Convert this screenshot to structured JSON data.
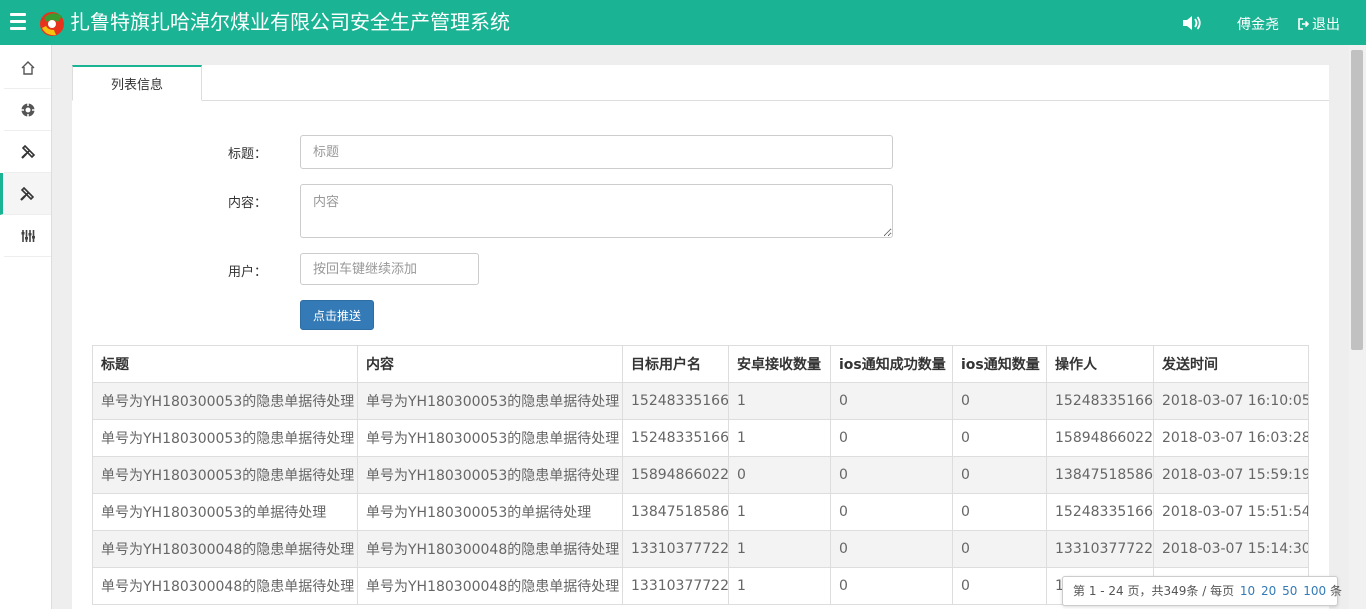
{
  "header": {
    "title": "扎鲁特旗扎哈淖尔煤业有限公司安全生产管理系统",
    "user": "傅金尧",
    "logout": "退出",
    "bg_color": "#1ab394"
  },
  "sidebar": {
    "items": [
      {
        "icon": "home-icon"
      },
      {
        "icon": "target-icon"
      },
      {
        "icon": "tools-icon"
      },
      {
        "icon": "tools-icon",
        "active": true
      },
      {
        "icon": "equalizer-icon"
      }
    ]
  },
  "tabs": [
    {
      "label": "列表信息",
      "active": true
    }
  ],
  "form": {
    "title_label": "标题：",
    "title_placeholder": "标题",
    "content_label": "内容：",
    "content_placeholder": "内容",
    "user_label": "用户：",
    "user_placeholder": "按回车键继续添加",
    "submit_label": "点击推送"
  },
  "table": {
    "columns": [
      "标题",
      "内容",
      "目标用户名",
      "安卓接收数量",
      "ios通知成功数量",
      "ios通知数量",
      "操作人",
      "发送时间"
    ],
    "rows": [
      [
        "单号为YH180300053的隐患单据待处理",
        "单号为YH180300053的隐患单据待处理",
        "15248335166",
        "1",
        "0",
        "0",
        "15248335166",
        "2018-03-07 16:10:05"
      ],
      [
        "单号为YH180300053的隐患单据待处理",
        "单号为YH180300053的隐患单据待处理",
        "15248335166",
        "1",
        "0",
        "0",
        "15894866022",
        "2018-03-07 16:03:28"
      ],
      [
        "单号为YH180300053的隐患单据待处理",
        "单号为YH180300053的隐患单据待处理",
        "15894866022",
        "0",
        "0",
        "0",
        "13847518586",
        "2018-03-07 15:59:19"
      ],
      [
        "单号为YH180300053的单据待处理",
        "单号为YH180300053的单据待处理",
        "13847518586",
        "1",
        "0",
        "0",
        "15248335166",
        "2018-03-07 15:51:54"
      ],
      [
        "单号为YH180300048的隐患单据待处理",
        "单号为YH180300048的隐患单据待处理",
        "13310377722",
        "1",
        "0",
        "0",
        "13310377722",
        "2018-03-07 15:14:30"
      ],
      [
        "单号为YH180300048的隐患单据待处理",
        "单号为YH180300048的隐患单据待处理",
        "13310377722",
        "1",
        "0",
        "0",
        "1",
        ""
      ]
    ]
  },
  "pager": {
    "summary": "第 1 - 24 页，共349条 / 每页",
    "sizes": [
      "10",
      "20",
      "50",
      "100"
    ],
    "suffix": "条"
  }
}
